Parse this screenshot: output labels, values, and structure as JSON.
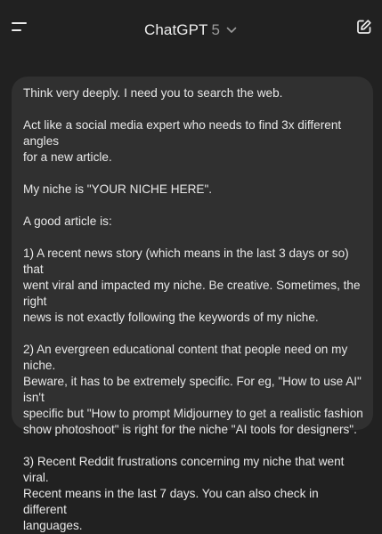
{
  "header": {
    "menu_icon": "menu-icon",
    "title": "ChatGPT",
    "version": "5",
    "dropdown_icon": "chevron-down-icon",
    "new_chat_icon": "edit-icon"
  },
  "message": {
    "paragraphs": [
      "Think very deeply. I need you to search the web.",
      "Act like a social media expert who needs to find 3x different angles\nfor a new article.",
      "My niche is \"YOUR NICHE HERE\".",
      "A good article is:",
      "1) A recent news story (which means in the last 3 days or so) that\nwent viral and impacted my niche. Be creative. Sometimes, the right\nnews is not exactly following the keywords of my niche.",
      "2) An evergreen educational content that people need on my niche.\nBeware, it has to be extremely specific. For eg, \"How to use AI\" isn't\nspecific but \"How to prompt Midjourney to get a realistic fashion\nshow photoshoot\" is right for the niche \"AI tools for designers\".",
      "3) Recent Reddit frustrations concerning my niche that went viral.\nRecent means in the last 7 days. You can also check in different\nlanguages."
    ]
  },
  "colors": {
    "background": "#212121",
    "bubble": "#303030",
    "text": "#ececec",
    "muted": "#9b9b9b"
  }
}
